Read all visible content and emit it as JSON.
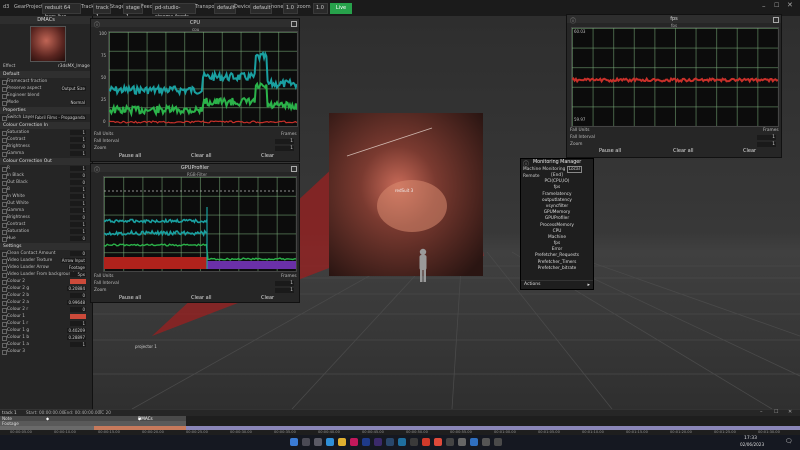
{
  "topbar": {
    "items": [
      "d3",
      "Gear",
      "Project",
      "redsuit 64 bars live",
      "Track",
      "track 1",
      "Stage",
      "stage 1",
      "Feed",
      "pd-studio-cinema-feeds",
      "Transport",
      "default",
      "Devices",
      "default",
      "none",
      "1.0",
      "zoom",
      "1.0",
      "Live"
    ]
  },
  "left_panel": {
    "title": "DMACs",
    "effect_label": "Effect",
    "effect_value": "r3dsMX_Image",
    "sections": [
      {
        "title": "Default",
        "rows": [
          {
            "label": "Framecast fraction",
            "value": ""
          },
          {
            "label": "Preserve aspect",
            "value": "Output Size"
          },
          {
            "label": "Engineer blend",
            "value": ""
          },
          {
            "label": "Mode",
            "value": "Normal"
          }
        ]
      },
      {
        "title": "Properties",
        "rows": [
          {
            "label": "Switch Layer",
            "value": "Fabril Films - Propaganda"
          }
        ]
      },
      {
        "title": "Colour Correction In",
        "rows": [
          {
            "label": "Saturation",
            "value": "1"
          },
          {
            "label": "Contrast",
            "value": "1"
          },
          {
            "label": "Brightness",
            "value": "0"
          },
          {
            "label": "Gamma",
            "value": "1"
          }
        ]
      },
      {
        "title": "Colour Correction Out",
        "rows": [
          {
            "label": "R",
            "value": "1"
          },
          {
            "label": "In Black",
            "value": "0"
          },
          {
            "label": "Out Black",
            "value": "0"
          },
          {
            "label": "B",
            "value": "1"
          },
          {
            "label": "In White",
            "value": "1"
          },
          {
            "label": "Out White",
            "value": "1"
          },
          {
            "label": "Gamma",
            "value": "1"
          },
          {
            "label": "Brightness",
            "value": "0"
          },
          {
            "label": "Contrast",
            "value": "1"
          },
          {
            "label": "Saturation",
            "value": "1"
          },
          {
            "label": "Hue",
            "value": "0"
          }
        ]
      },
      {
        "title": "Settings",
        "rows": [
          {
            "label": "Clean Contact Amount",
            "value": "0"
          },
          {
            "label": "Video Loader Texture",
            "value": "Arrow Input"
          },
          {
            "label": "Video Loader Arrow",
            "value": "Footage"
          },
          {
            "label": "Video Loader From background",
            "value": "5px"
          },
          {
            "label": "Colour 2",
            "value": ""
          },
          {
            "label": "Colour 2 g",
            "value": "0.20884"
          },
          {
            "label": "Colour 2 b",
            "value": "0"
          },
          {
            "label": "Colour 2 a",
            "value": "0.99648"
          },
          {
            "label": "Colour 2 r",
            "value": "0"
          },
          {
            "label": "Colour 1",
            "value": ""
          },
          {
            "label": "Colour 1 r",
            "value": "1"
          },
          {
            "label": "Colour 1 g",
            "value": "0.40209"
          },
          {
            "label": "Colour 1 b",
            "value": "0.28897"
          },
          {
            "label": "Colour 1 a",
            "value": "1"
          },
          {
            "label": "Colour 3",
            "value": ""
          }
        ]
      }
    ]
  },
  "cpu_panel": {
    "title": "CPU",
    "subtitle": "cpu",
    "y_ticks": [
      "100",
      "75",
      "50",
      "25",
      "0"
    ],
    "rows": [
      {
        "label": "Fall Units",
        "value": "Frames"
      },
      {
        "label": "Fall Interval",
        "value": "1"
      },
      {
        "label": "Zoom",
        "value": "1"
      }
    ],
    "buttons": [
      "Pause all",
      "Clear all",
      "Clear"
    ]
  },
  "gpu_panel": {
    "title": "GPUProfiler",
    "subtitle": "RGB-Filter",
    "rows": [
      {
        "label": "Fall Units",
        "value": "Frames"
      },
      {
        "label": "Fall Interval",
        "value": "1"
      },
      {
        "label": "Zoom",
        "value": "1"
      }
    ],
    "buttons": [
      "Pause all",
      "Clear all",
      "Clear"
    ]
  },
  "fps_panel": {
    "title": "fps",
    "subtitle": "fps",
    "y_ticks": [
      "60.03",
      "59.97"
    ],
    "rows": [
      {
        "label": "Fall Units",
        "value": "Frames"
      },
      {
        "label": "Fall Interval",
        "value": "1"
      },
      {
        "label": "Zoom",
        "value": "1"
      }
    ],
    "buttons": [
      "Pause all",
      "Clear all",
      "Clear"
    ]
  },
  "monitor_manager": {
    "title": "Monitoring Manager",
    "subtitle": "Machine Monitoring",
    "local_button": "Local",
    "remote_label": "Remote",
    "items": [
      "Local",
      "[End]",
      "PCI(CPU,IO)",
      "fps",
      "Framelatency",
      "outputlatency",
      "vsyncfilter",
      "GPUMemory",
      "GPUProfiler",
      "ProcessMemory",
      "CPU",
      "Machine",
      "fps",
      "Error",
      "Prefetcher_Requests",
      "Prefetcher_Timers",
      "Prefetcher_bitrate"
    ],
    "actions_label": "Actions"
  },
  "viewport": {
    "screen_label": "redSuit 3",
    "projector_label": "projector 1"
  },
  "timeline": {
    "track_label": "track 1",
    "start_label": "Start: 00:00:00.00",
    "end_label": "End: 00:40:00.00",
    "tc_label": "TC 20",
    "layer1": "Note",
    "layer1_clip": "DMACs",
    "layer2": "Footage",
    "ticks": [
      "00:00:05.00",
      "00:00:10.00",
      "00:00:15.00",
      "00:00:20.00",
      "00:00:25.00",
      "00:00:30.00",
      "00:00:35.00",
      "00:00:40.00",
      "00:00:45.00",
      "00:00:50.00",
      "00:00:55.00",
      "00:01:00.00",
      "00:01:05.00",
      "00:01:10.00",
      "00:01:15.00",
      "00:01:20.00",
      "00:01:25.00",
      "00:01:30.00"
    ]
  },
  "taskbar": {
    "time": "17:33",
    "date": "02/06/2023"
  },
  "colors": {
    "cpu_series_cyan": "#1aa0a0",
    "cpu_series_green": "#2bb34a",
    "cpu_series_red": "#c8302a",
    "live_green": "#27a14b",
    "accent_red": "#cc4a3a"
  }
}
